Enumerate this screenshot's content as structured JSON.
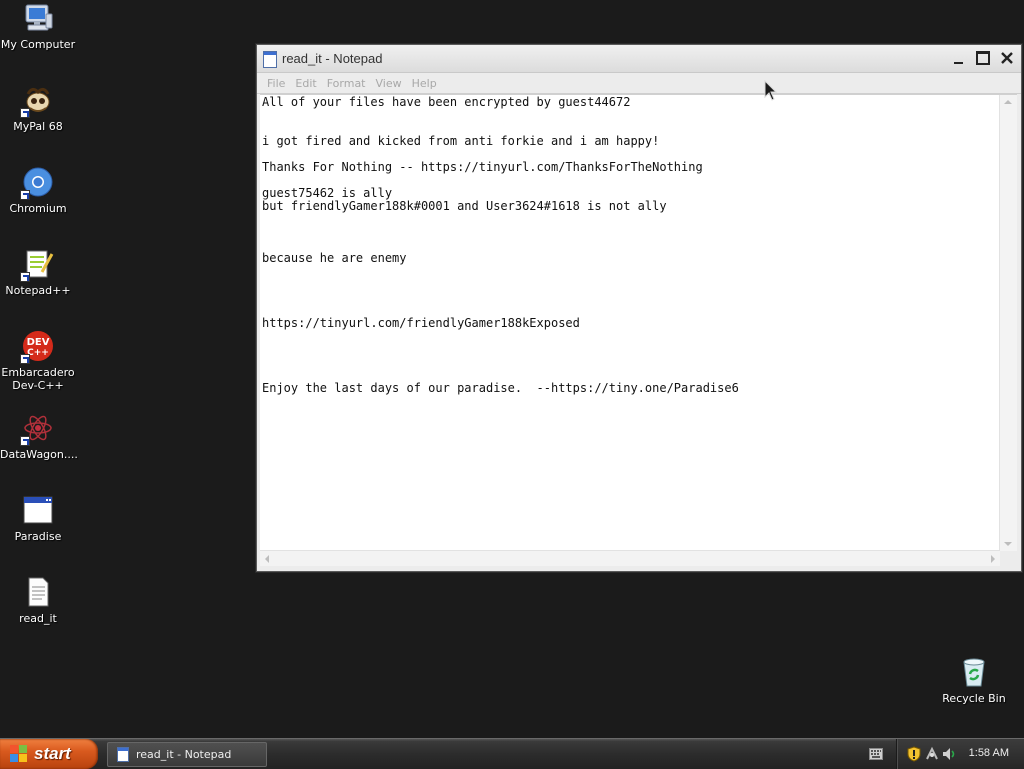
{
  "desktop": {
    "icons": [
      {
        "label": "My Computer",
        "icon": "computer-icon"
      },
      {
        "label": "MyPal 68",
        "icon": "mypal-icon"
      },
      {
        "label": "Chromium",
        "icon": "chromium-icon"
      },
      {
        "label": "Notepad++",
        "icon": "notepadpp-icon"
      },
      {
        "label": "Embarcadero Dev-C++",
        "icon": "devcpp-icon",
        "icon_text": "DEV C++"
      },
      {
        "label": "DataWagon....",
        "icon": "datawagon-icon"
      },
      {
        "label": "Paradise",
        "icon": "app-window-icon"
      },
      {
        "label": "read_it",
        "icon": "text-file-icon"
      },
      {
        "label": "Recycle Bin",
        "icon": "recycle-bin-icon"
      }
    ]
  },
  "notepad": {
    "title": "read_it - Notepad",
    "menu": [
      "File",
      "Edit",
      "Format",
      "View",
      "Help"
    ],
    "lines": [
      "All of your files have been encrypted by guest44672",
      "i got fired and kicked from anti forkie and i am happy!",
      "Thanks For Nothing -- https://tinyurl.com/ThanksForTheNothing",
      "guest75462 is ally",
      "but friendlyGamer188k#0001 and User3624#1618 is not ally",
      "because he are enemy",
      "https://tinyurl.com/friendlyGamer188kExposed",
      "Enjoy the last days of our paradise.  --https://tiny.one/Paradise6"
    ]
  },
  "taskbar": {
    "start_label": "start",
    "task_item": "read_it - Notepad",
    "clock": "1:58 AM"
  },
  "colors": {
    "desktop_bg": "#1b1b1b",
    "start_button": "#d95a1e",
    "taskbar": "#2c2c2c"
  }
}
